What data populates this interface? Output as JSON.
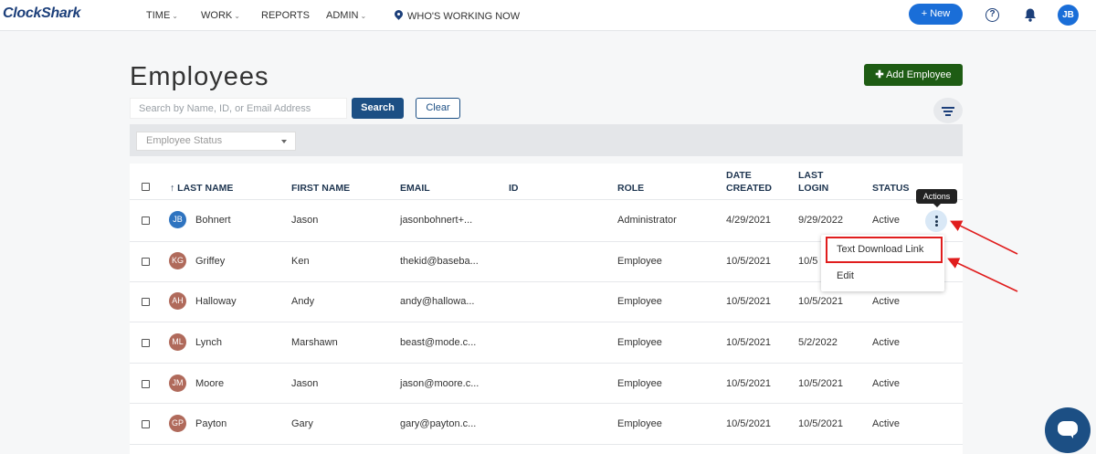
{
  "header": {
    "logo": "ClockShark",
    "nav": [
      {
        "label": "TIME",
        "dropdown": true
      },
      {
        "label": "WORK",
        "dropdown": true
      },
      {
        "label": "REPORTS",
        "dropdown": false
      },
      {
        "label": "ADMIN",
        "dropdown": true
      },
      {
        "label": "WHO'S WORKING NOW",
        "dropdown": false,
        "icon": "map-pin-icon"
      }
    ],
    "chevron": "⌄",
    "new_button": "+ New",
    "help_glyph": "?",
    "user_initials": "JB"
  },
  "page": {
    "title": "Employees",
    "add_button": "Add Employee",
    "search_placeholder": "Search by Name, ID, or Email Address",
    "search_button": "Search",
    "clear_button": "Clear",
    "status_filter_placeholder": "Employee Status"
  },
  "table": {
    "headers": {
      "last_name": "LAST NAME",
      "sort_arrow": "↑",
      "first_name": "FIRST NAME",
      "email": "EMAIL",
      "id": "ID",
      "role": "ROLE",
      "date_created_1": "DATE",
      "date_created_2": "CREATED",
      "last_login_1": "LAST",
      "last_login_2": "LOGIN",
      "status": "STATUS"
    },
    "rows": [
      {
        "initials": "JB",
        "avatar_color": "#2f74c0",
        "last": "Bohnert",
        "first": "Jason",
        "email": "jasonbohnert+...",
        "id": "",
        "role": "Administrator",
        "created": "4/29/2021",
        "login": "9/29/2022",
        "status": "Active"
      },
      {
        "initials": "KG",
        "avatar_color": "#b06a5b",
        "last": "Griffey",
        "first": "Ken",
        "email": "thekid@baseba...",
        "id": "",
        "role": "Employee",
        "created": "10/5/2021",
        "login": "10/5",
        "status": ""
      },
      {
        "initials": "AH",
        "avatar_color": "#b06a5b",
        "last": "Halloway",
        "first": "Andy",
        "email": "andy@hallowa...",
        "id": "",
        "role": "Employee",
        "created": "10/5/2021",
        "login": "10/5/2021",
        "status": "Active"
      },
      {
        "initials": "ML",
        "avatar_color": "#b06a5b",
        "last": "Lynch",
        "first": "Marshawn",
        "email": "beast@mode.c...",
        "id": "",
        "role": "Employee",
        "created": "10/5/2021",
        "login": "5/2/2022",
        "status": "Active"
      },
      {
        "initials": "JM",
        "avatar_color": "#b06a5b",
        "last": "Moore",
        "first": "Jason",
        "email": "jason@moore.c...",
        "id": "",
        "role": "Employee",
        "created": "10/5/2021",
        "login": "10/5/2021",
        "status": "Active"
      },
      {
        "initials": "GP",
        "avatar_color": "#b06a5b",
        "last": "Payton",
        "first": "Gary",
        "email": "gary@payton.c...",
        "id": "",
        "role": "Employee",
        "created": "10/5/2021",
        "login": "10/5/2021",
        "status": "Active"
      }
    ]
  },
  "actions": {
    "tooltip": "Actions",
    "menu": [
      "Text Download Link",
      "Edit"
    ]
  },
  "colors": {
    "brand_blue": "#1c4f84",
    "add_green": "#1e5c14",
    "annotation_red": "#e01d1d"
  }
}
